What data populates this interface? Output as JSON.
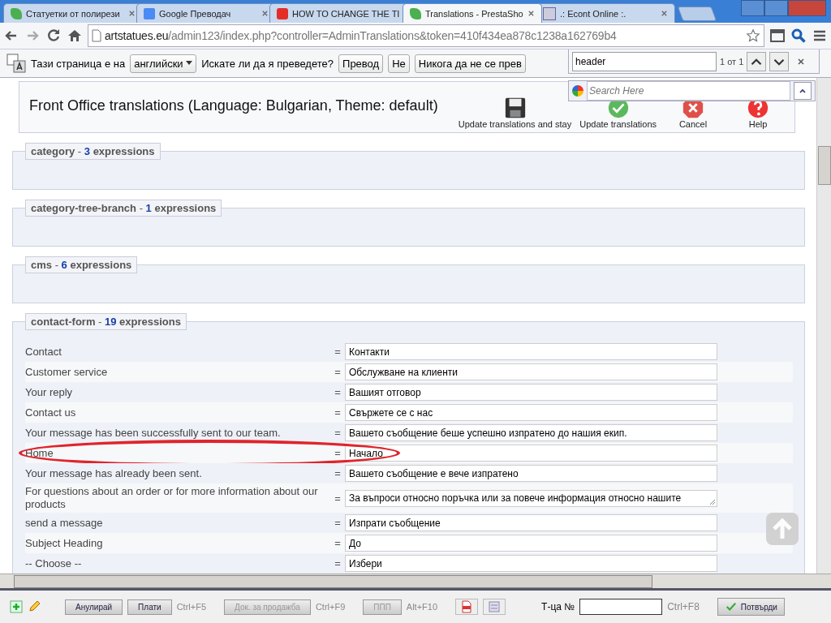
{
  "tabs": [
    {
      "title": "Статуетки от полирези",
      "kind": "leaf",
      "selected": false
    },
    {
      "title": "Google Преводач",
      "kind": "translate",
      "selected": false
    },
    {
      "title": "HOW TO CHANGE THE TI",
      "kind": "play",
      "selected": false
    },
    {
      "title": "Translations - PrestaSho",
      "kind": "leaf",
      "selected": true
    },
    {
      "title": ".: Econt Online :.",
      "kind": "doc",
      "selected": false
    }
  ],
  "address": {
    "host": "artstatues.eu",
    "path": "/admin123/index.php?controller=AdminTranslations&token=410f434ea878c1238a162769b4"
  },
  "translate_bar": {
    "text": "Тази страница е на",
    "language": "английски",
    "question": "Искате ли да я преведете?",
    "buttons": [
      "Превод",
      "Не",
      "Никога да не се прев"
    ]
  },
  "find_bar": {
    "query": "header",
    "count": "1 от 1"
  },
  "search_overlay": {
    "placeholder": "Search Here"
  },
  "header": {
    "title": "Front Office translations (Language: Bulgarian, Theme: default)",
    "buttons": [
      {
        "label": "Update translations and stay",
        "kind": "save"
      },
      {
        "label": "Update translations",
        "kind": "ok"
      },
      {
        "label": "Cancel",
        "kind": "cancel"
      },
      {
        "label": "Help",
        "kind": "help"
      }
    ]
  },
  "sections": [
    {
      "name": "category",
      "separator": "-",
      "count": "3",
      "suffix": "expressions"
    },
    {
      "name": "category-tree-branch",
      "separator": "-",
      "count": "1",
      "suffix": "expressions"
    },
    {
      "name": "cms",
      "separator": "-",
      "count": "6",
      "suffix": "expressions"
    },
    {
      "name": "contact-form",
      "separator": "-",
      "count": "19",
      "suffix": "expressions",
      "rows": [
        {
          "source": "Contact",
          "eq": "=",
          "value": "Контакти",
          "kind": "input",
          "highlighted": false
        },
        {
          "source": "Customer service",
          "eq": "=",
          "value": "Обслужване на клиенти",
          "kind": "input",
          "highlighted": false
        },
        {
          "source": "Your reply",
          "eq": "=",
          "value": "Вашият отговор",
          "kind": "input",
          "highlighted": false
        },
        {
          "source": "Contact us",
          "eq": "=",
          "value": "Свържете се с нас",
          "kind": "input",
          "highlighted": false
        },
        {
          "source": "Your message has been successfully sent to our team.",
          "eq": "=",
          "value": "Вашето съобщение беше успешно изпратено до нашия екип.",
          "kind": "input",
          "highlighted": false
        },
        {
          "source": "Home",
          "eq": "=",
          "value": "Начало",
          "kind": "input",
          "highlighted": true
        },
        {
          "source": "Your message has already been sent.",
          "eq": "=",
          "value": "Вашето съобщение е вече изпратено",
          "kind": "input",
          "highlighted": false
        },
        {
          "source": "For questions about an order or for more information about our products",
          "eq": "=",
          "value": "За въпроси относно поръчка или за повече информация относно нашите",
          "kind": "textarea",
          "highlighted": false
        },
        {
          "source": "send a message",
          "eq": "=",
          "value": "Изпрати съобщение",
          "kind": "input",
          "highlighted": false
        },
        {
          "source": "Subject Heading",
          "eq": "=",
          "value": "До",
          "kind": "input",
          "highlighted": false
        },
        {
          "source": "-- Choose --",
          "eq": "=",
          "value": "Избери",
          "kind": "input",
          "highlighted": false
        }
      ]
    }
  ],
  "taskbar": {
    "items": [
      {
        "kind": "button",
        "label": "Анулирай",
        "disabled": false
      },
      {
        "kind": "button",
        "label": "Плати",
        "disabled": false
      },
      {
        "kind": "hint",
        "label": "Ctrl+F5"
      },
      {
        "kind": "button",
        "label": "Док. за продажба",
        "disabled": true
      },
      {
        "kind": "hint",
        "label": "Ctrl+F9"
      },
      {
        "kind": "button",
        "label": "ППП",
        "disabled": true
      },
      {
        "kind": "hint",
        "label": "Alt+F10"
      }
    ],
    "field_label": "Т-ца №",
    "field_hint": "Ctrl+F8",
    "confirm": "Потвърди"
  }
}
